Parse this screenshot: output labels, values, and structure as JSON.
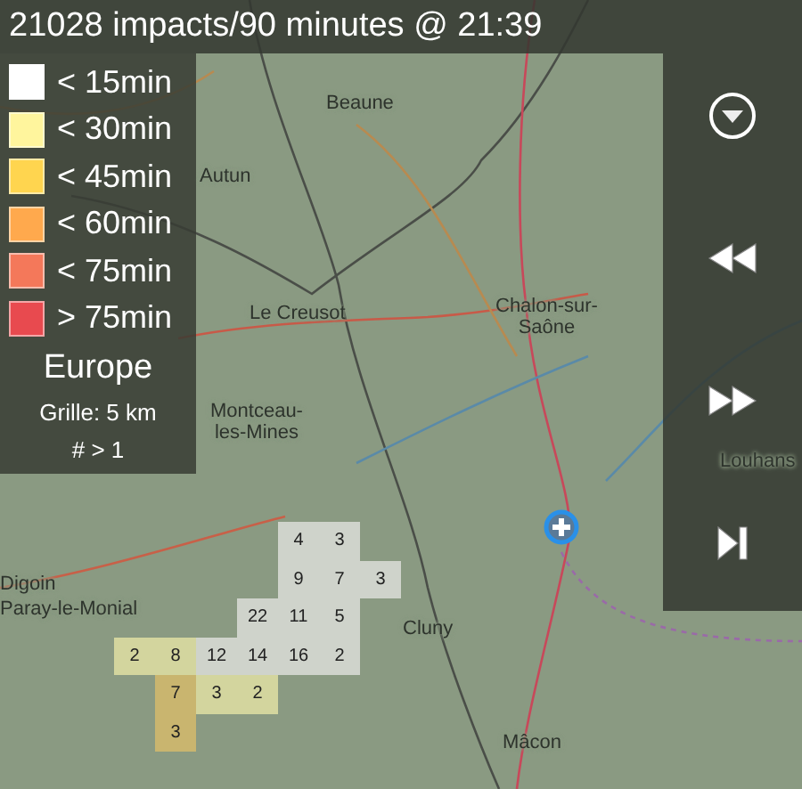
{
  "header": {
    "title": "21028 impacts/90 minutes @ 21:39"
  },
  "legend": {
    "items": [
      {
        "label": "< 15min",
        "color": "#ffffff"
      },
      {
        "label": "< 30min",
        "color": "#fff59d"
      },
      {
        "label": "< 45min",
        "color": "#ffd54f"
      },
      {
        "label": "< 60min",
        "color": "#ffa94d"
      },
      {
        "label": "< 75min",
        "color": "#f4785a"
      },
      {
        "label": "> 75min",
        "color": "#e84a4f"
      }
    ],
    "region": "Europe",
    "grid": "Grille: 5 km",
    "threshold": "# > 1"
  },
  "map": {
    "places": [
      "Beaune",
      "Autun",
      "Le Creusot",
      "Chalon-sur-\nSaône",
      "Montceau-\nles-Mines",
      "Digoin",
      "Paray-le-Monial",
      "Cluny",
      "Louhans",
      "Mâcon"
    ],
    "grid_rows": [
      [
        null,
        null,
        null,
        null,
        {
          "count": "4",
          "color": "#cfd3cb"
        },
        {
          "count": "3",
          "color": "#cfd3cb"
        },
        null
      ],
      [
        null,
        null,
        null,
        null,
        {
          "count": "9",
          "color": "#cfd3cb"
        },
        {
          "count": "7",
          "color": "#cfd3cb"
        },
        {
          "count": "3",
          "color": "#cfd3cb"
        }
      ],
      [
        null,
        null,
        null,
        {
          "count": "22",
          "color": "#cfd3cb"
        },
        {
          "count": "11",
          "color": "#cfd3cb"
        },
        {
          "count": "5",
          "color": "#cfd3cb"
        },
        null
      ],
      [
        {
          "count": "2",
          "color": "#d3d59e"
        },
        {
          "count": "8",
          "color": "#d3d59e"
        },
        {
          "count": "12",
          "color": "#cfd3cb"
        },
        {
          "count": "14",
          "color": "#cfd3cb"
        },
        {
          "count": "16",
          "color": "#cfd3cb"
        },
        {
          "count": "2",
          "color": "#cfd3cb"
        },
        null
      ],
      [
        null,
        {
          "count": "7",
          "color": "#c9b56f"
        },
        {
          "count": "3",
          "color": "#d3d59e"
        },
        {
          "count": "2",
          "color": "#d3d59e"
        },
        null,
        null,
        null
      ],
      [
        null,
        {
          "count": "3",
          "color": "#c9b56f"
        },
        null,
        null,
        null,
        null,
        null
      ]
    ]
  },
  "controls": [
    {
      "kind": "menu"
    },
    {
      "kind": "rewind"
    },
    {
      "kind": "forward"
    },
    {
      "kind": "end"
    }
  ]
}
